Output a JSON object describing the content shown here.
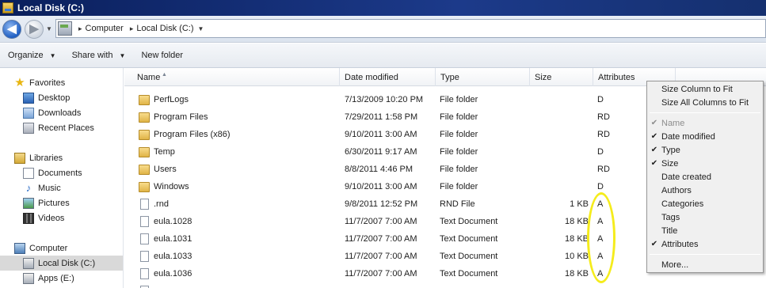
{
  "window": {
    "title": "Local Disk (C:)"
  },
  "address": {
    "crumbs": [
      "Computer",
      "Local Disk (C:)"
    ],
    "back_glyph": "◀",
    "fwd_glyph": "▶"
  },
  "toolbar": {
    "organize": "Organize",
    "share_with": "Share with",
    "new_folder": "New folder"
  },
  "nav": {
    "favorites": "Favorites",
    "desktop": "Desktop",
    "downloads": "Downloads",
    "recent": "Recent Places",
    "libraries": "Libraries",
    "documents": "Documents",
    "music": "Music",
    "pictures": "Pictures",
    "videos": "Videos",
    "computer": "Computer",
    "local_disk": "Local Disk (C:)",
    "apps": "Apps (E:)"
  },
  "columns": {
    "name": "Name",
    "date": "Date modified",
    "type": "Type",
    "size": "Size",
    "attributes": "Attributes"
  },
  "files": [
    {
      "name": "PerfLogs",
      "date": "7/13/2009 10:20 PM",
      "type": "File folder",
      "size": "",
      "attr": "D",
      "kind": "folder"
    },
    {
      "name": "Program Files",
      "date": "7/29/2011 1:58 PM",
      "type": "File folder",
      "size": "",
      "attr": "RD",
      "kind": "folder"
    },
    {
      "name": "Program Files (x86)",
      "date": "9/10/2011 3:00 AM",
      "type": "File folder",
      "size": "",
      "attr": "RD",
      "kind": "folder"
    },
    {
      "name": "Temp",
      "date": "6/30/2011 9:17 AM",
      "type": "File folder",
      "size": "",
      "attr": "D",
      "kind": "folder"
    },
    {
      "name": "Users",
      "date": "8/8/2011 4:46 PM",
      "type": "File folder",
      "size": "",
      "attr": "RD",
      "kind": "folder"
    },
    {
      "name": "Windows",
      "date": "9/10/2011 3:00 AM",
      "type": "File folder",
      "size": "",
      "attr": "D",
      "kind": "folder"
    },
    {
      "name": ".rnd",
      "date": "9/8/2011 12:52 PM",
      "type": "RND File",
      "size": "1 KB",
      "attr": "A",
      "kind": "file"
    },
    {
      "name": "eula.1028",
      "date": "11/7/2007 7:00 AM",
      "type": "Text Document",
      "size": "18 KB",
      "attr": "A",
      "kind": "file"
    },
    {
      "name": "eula.1031",
      "date": "11/7/2007 7:00 AM",
      "type": "Text Document",
      "size": "18 KB",
      "attr": "A",
      "kind": "file"
    },
    {
      "name": "eula.1033",
      "date": "11/7/2007 7:00 AM",
      "type": "Text Document",
      "size": "10 KB",
      "attr": "A",
      "kind": "file"
    },
    {
      "name": "eula.1036",
      "date": "11/7/2007 7:00 AM",
      "type": "Text Document",
      "size": "18 KB",
      "attr": "A",
      "kind": "file"
    }
  ],
  "context_menu": [
    {
      "label": "Size Column to Fit",
      "checked": false,
      "disabled": false
    },
    {
      "label": "Size All Columns to Fit",
      "checked": false,
      "disabled": false
    },
    {
      "separator": true
    },
    {
      "label": "Name",
      "checked": true,
      "disabled": true
    },
    {
      "label": "Date modified",
      "checked": true,
      "disabled": false
    },
    {
      "label": "Type",
      "checked": true,
      "disabled": false
    },
    {
      "label": "Size",
      "checked": true,
      "disabled": false
    },
    {
      "label": "Date created",
      "checked": false,
      "disabled": false
    },
    {
      "label": "Authors",
      "checked": false,
      "disabled": false
    },
    {
      "label": "Categories",
      "checked": false,
      "disabled": false
    },
    {
      "label": "Tags",
      "checked": false,
      "disabled": false
    },
    {
      "label": "Title",
      "checked": false,
      "disabled": false
    },
    {
      "label": "Attributes",
      "checked": true,
      "disabled": false
    },
    {
      "separator": true
    },
    {
      "label": "More...",
      "checked": false,
      "disabled": false
    }
  ],
  "colors": {
    "highlight_ellipse": "#f5ec1c",
    "title_bar": "#0a246a"
  }
}
